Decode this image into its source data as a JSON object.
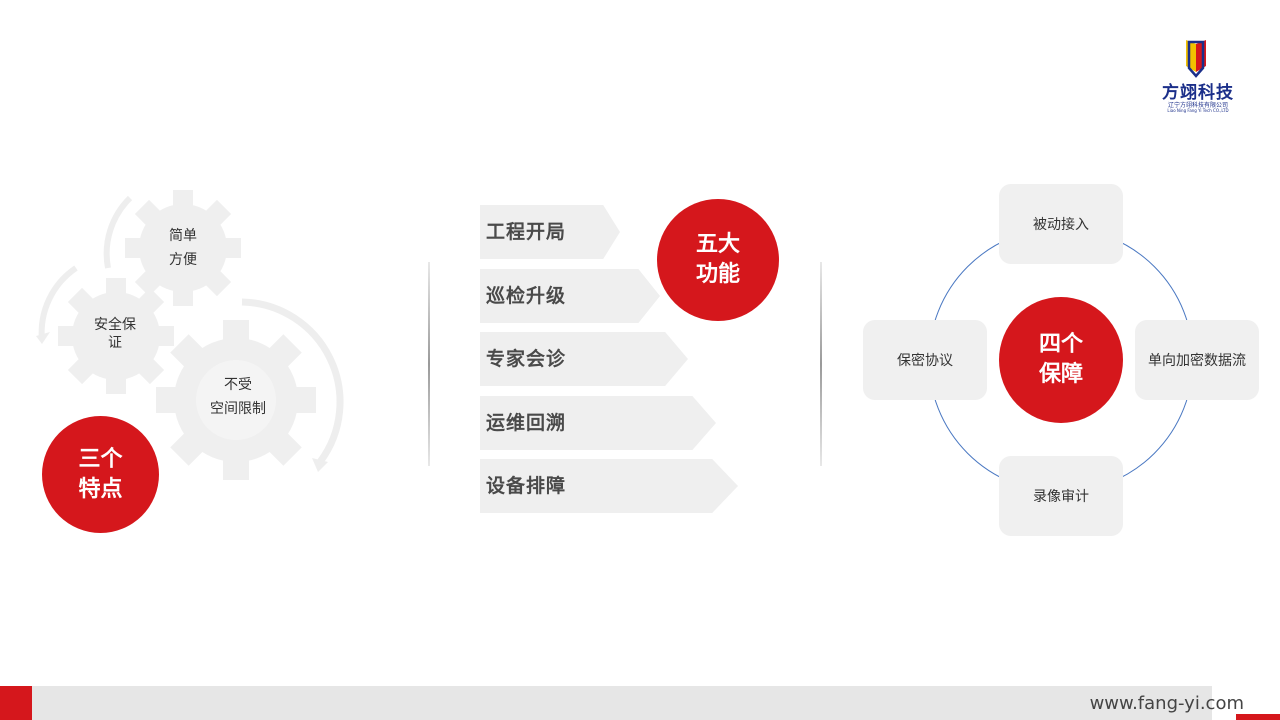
{
  "logo": {
    "brand": "方翊科技",
    "company_cn": "辽宁方翊科技有限公司",
    "company_en": "Liao Ning Fang Yi Tech CO.,LTD"
  },
  "features": {
    "badge_line1": "三个",
    "badge_line2": "特点",
    "gear1_line1": "简单",
    "gear1_line2": "方便",
    "gear2_line1": "安全保",
    "gear2_line2": "证",
    "gear3_line1": "不受",
    "gear3_line2": "空间限制"
  },
  "functions": {
    "badge_line1": "五大",
    "badge_line2": "功能",
    "items": [
      "工程开局",
      "巡检升级",
      "专家会诊",
      "运维回溯",
      "设备排障"
    ]
  },
  "guarantees": {
    "center_line1": "四个",
    "center_line2": "保障",
    "top": "被动接入",
    "left": "保密协议",
    "right": "单向加密数据流",
    "bottom": "录像审计"
  },
  "footer": {
    "url": "www.fang-yi.com"
  },
  "colors": {
    "accent": "#d5171c",
    "brand_blue": "#1b2f8a",
    "panel_gray": "#efefef"
  }
}
